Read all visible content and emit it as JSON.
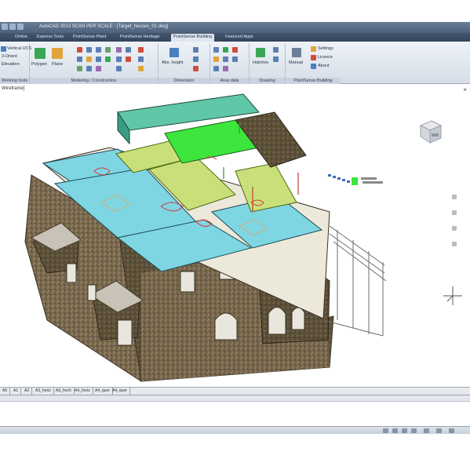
{
  "window": {
    "title": "AutoCAD 2013  SCAN PER SCALE - [Target_houses_01.dwg]"
  },
  "ribbon_tabs": [
    "",
    "Online",
    "Express Tools",
    "PointSense Plant",
    "PointSense Heritage",
    "PointSense Building",
    "Featured Apps"
  ],
  "active_tab_index": 5,
  "ribbon": {
    "ucs_group": {
      "items": [
        "Vertical UCS",
        "3-Orient",
        "Elevation"
      ],
      "label": "Working tools"
    },
    "modeling_group": {
      "items": [
        "Polygon",
        "Plane"
      ],
      "label": "Modeling / Construction"
    },
    "dimension_group": {
      "items": [
        "Abs. height"
      ],
      "label": "Dimension"
    },
    "area_group": {
      "label": "Area data"
    },
    "drawing_group": {
      "items": [
        "Hatches"
      ],
      "label": "Drawing"
    },
    "pointsense_group": {
      "items": [
        "Manual",
        "Settings",
        "Licence",
        "About"
      ],
      "label": "PointSense Building"
    }
  },
  "viewport": {
    "label": "Wireframe]",
    "close": "×"
  },
  "layout_tabs": [
    "A0",
    "A1",
    "A2",
    "A3_horiz",
    "A3_hoch",
    "A4_horiz",
    "A4_quer",
    "A4_quer"
  ],
  "colors": {
    "roof_cyan": "#7fd6e3",
    "roof_green": "#3ce63c",
    "roof_yellowgreen": "#c9e07a",
    "roof_teal": "#5fc7a8",
    "brick": "#7a6a4f",
    "title_bar": "#4e617d"
  },
  "icons": [
    "ucs-icon",
    "polygon-icon",
    "plane-icon",
    "height-icon",
    "hatch-icon",
    "manual-icon",
    "settings-icon",
    "licence-icon",
    "about-icon",
    "viewcube-icon",
    "ucs-axis-icon"
  ]
}
